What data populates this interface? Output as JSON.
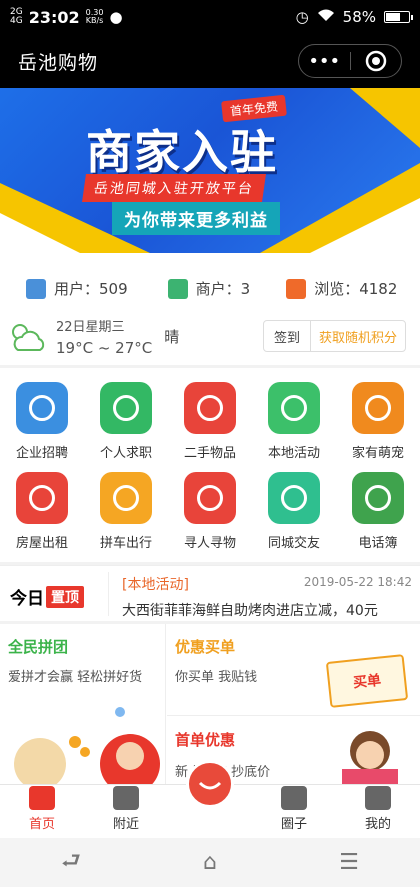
{
  "status": {
    "signal1": "2G",
    "signal2": "4G",
    "time": "23:02",
    "speed_value": "0.30",
    "speed_unit": "KB/s",
    "battery": "58%",
    "battery_level": 0.58
  },
  "navbar": {
    "title": "岳池购物"
  },
  "banner": {
    "badge": "首年免费",
    "headline": "商家入驻",
    "sub1": "岳池同城入驻开放平台",
    "sub2": "为你带来更多利益"
  },
  "stats": {
    "users_label": "用户：509",
    "merchants_label": "商户：3",
    "views_label": "浏览：4182"
  },
  "weather": {
    "date": "22日星期三",
    "temp": "19°C ~ 27°C",
    "condition": "晴"
  },
  "signin": {
    "sign_label": "签到",
    "points_label": "获取随机积分"
  },
  "categories": [
    {
      "label": "企业招聘",
      "color": "#3b8fe0",
      "icon": "clock-icon"
    },
    {
      "label": "个人求职",
      "color": "#33b864",
      "icon": "id-card-icon"
    },
    {
      "label": "二手物品",
      "color": "#e8443a",
      "icon": "basket-icon"
    },
    {
      "label": "本地活动",
      "color": "#3cc06a",
      "icon": "balloon-icon"
    },
    {
      "label": "家有萌宠",
      "color": "#f08a1e",
      "icon": "paw-icon"
    },
    {
      "label": "房屋出租",
      "color": "#e8443a",
      "icon": "house-icon"
    },
    {
      "label": "拼车出行",
      "color": "#f5a623",
      "icon": "car-icon"
    },
    {
      "label": "寻人寻物",
      "color": "#e8443a",
      "icon": "location-heart-icon"
    },
    {
      "label": "同城交友",
      "color": "#2fbf8f",
      "icon": "chat-icon"
    },
    {
      "label": "电话簿",
      "color": "#3fa34d",
      "icon": "phone-book-icon"
    }
  ],
  "news": {
    "logo_text": "今日",
    "logo_tag": "置顶",
    "category": "[本地活动]",
    "date": "2019-05-22 18:42",
    "text": "大西街菲菲海鲜自助烤肉进店立减，40元"
  },
  "promos": {
    "group_title": "全民拼团",
    "group_sub": "爱拼才会赢 轻松拼好货",
    "discount_title": "优惠买单",
    "discount_sub": "你买单 我贴钱",
    "discount_tag": "买单",
    "first_title": "首单优惠",
    "first_sub": "新人独享 抄底价"
  },
  "tabs": [
    {
      "label": "首页",
      "active": true
    },
    {
      "label": "附近",
      "active": false
    },
    {
      "label": "",
      "active": false
    },
    {
      "label": "圈子",
      "active": false
    },
    {
      "label": "我的",
      "active": false
    }
  ],
  "colors": {
    "accent": "#e8372c",
    "banner_blue": "#1a55d6",
    "highlight_orange": "#f0a020"
  }
}
